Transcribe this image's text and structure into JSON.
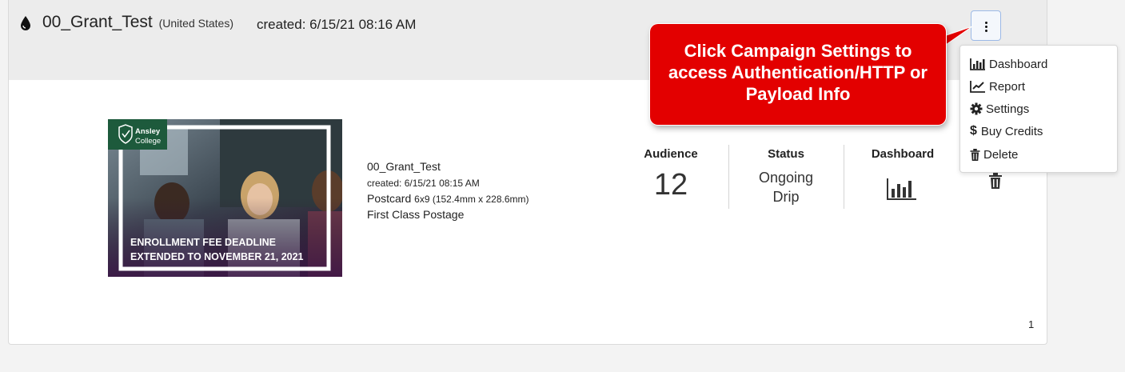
{
  "header": {
    "campaign_name": "00_Grant_Test",
    "country": "(United States)",
    "created": "created: 6/15/21 08:16 AM",
    "menu_button_icon": "vertical-ellipsis-icon",
    "campaign_icon": "droplet-icon"
  },
  "thumbnail": {
    "brand_line1": "Ansley",
    "brand_line2": "College",
    "headline_line1": "ENROLLMENT FEE DEADLINE",
    "headline_line2": "EXTENDED TO NOVEMBER 21, 2021"
  },
  "details": {
    "name": "00_Grant_Test",
    "created": "created: 6/15/21 08:15 AM",
    "product": "Postcard",
    "size": "6x9 (152.4mm x 228.6mm)",
    "postage": "First Class Postage"
  },
  "stats": {
    "audience_label": "Audience",
    "audience_value": "12",
    "status_label": "Status",
    "status_line1": "Ongoing",
    "status_line2": "Drip",
    "dashboard_label": "Dashboard"
  },
  "menu": {
    "items": [
      {
        "label": "Dashboard",
        "icon": "bar-chart-icon"
      },
      {
        "label": "Report",
        "icon": "line-chart-icon"
      },
      {
        "label": "Settings",
        "icon": "gear-icon"
      },
      {
        "label": "Buy Credits",
        "icon": "dollar-icon"
      },
      {
        "label": "Delete",
        "icon": "trash-icon"
      }
    ]
  },
  "callout": {
    "line1": "Click Campaign Settings to",
    "line2": "access Authentication/HTTP or",
    "line3": "Payload Info"
  },
  "pagination": {
    "current": "1"
  },
  "colors": {
    "accent_red": "#e30000",
    "header_bg": "#ececec",
    "brand_green": "#1d5a3c"
  }
}
